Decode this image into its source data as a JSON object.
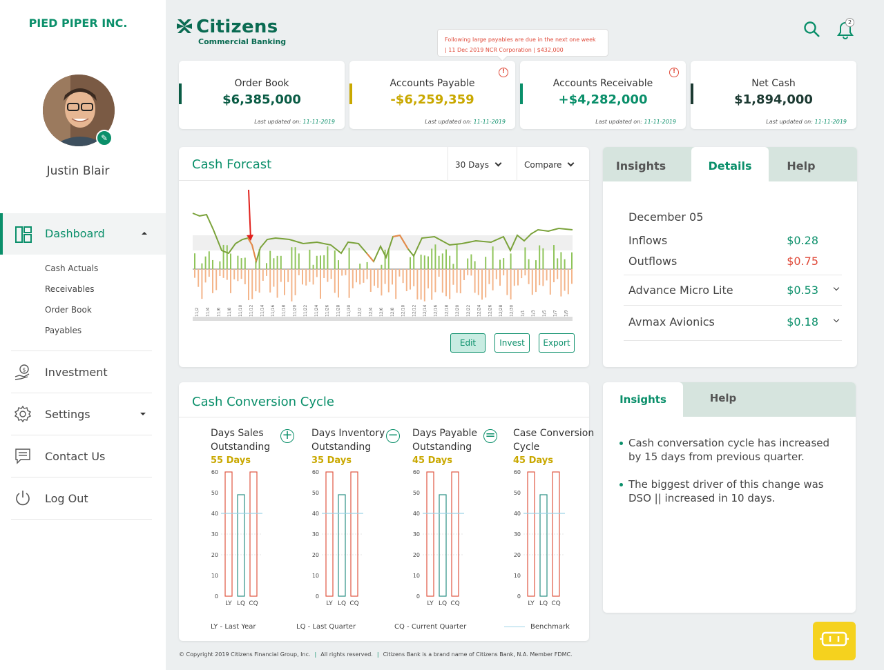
{
  "sidebar": {
    "company": "PIED PIPER INC.",
    "user_name": "Justin Blair",
    "active_item": "Dashboard",
    "sub_items": [
      "Cash Actuals",
      "Receivables",
      "Order Book",
      "Payables"
    ],
    "items": [
      "Investment",
      "Settings",
      "Contact Us",
      "Log Out"
    ]
  },
  "header": {
    "brand": "Citizens",
    "brand_sub": "Commercial Banking",
    "notification_count": "2"
  },
  "tooltip": {
    "line1": "Following large payables are due in the next one week",
    "line2": "| 11 Dec 2019 NCR Corporation  | $432,000"
  },
  "kpis": [
    {
      "title": "Order Book",
      "value": "$6,385,000",
      "updated_label": "Last updated on:",
      "updated": "11-11-2019",
      "color": "#0a5c45"
    },
    {
      "title": "Accounts Payable",
      "value": "-$6,259,359",
      "updated_label": "Last updated on:",
      "updated": "11-11-2019",
      "color": "#c9a800"
    },
    {
      "title": "Accounts Receivable",
      "value": "+$4,282,000",
      "updated_label": "Last updated on:",
      "updated": "11-11-2019",
      "color": "#0a8f6a"
    },
    {
      "title": "Net Cash",
      "value": "$1,894,000",
      "updated_label": "Last updated on:",
      "updated": "11-11-2019",
      "color": "#1c3a32"
    }
  ],
  "forecast": {
    "title": "Cash Forcast",
    "range": "30 Days",
    "compare": "Compare",
    "buttons": {
      "edit": "Edit",
      "invest": "Invest",
      "export": "Export"
    },
    "dates": [
      "11/2",
      "11/4",
      "11/6",
      "11/8",
      "11/10",
      "11/12",
      "11/14",
      "11/16",
      "11/18",
      "11/20",
      "11/22",
      "11/24",
      "11/26",
      "11/28",
      "11/30",
      "12/2",
      "12/4",
      "12/6",
      "12/8",
      "12/10",
      "12/12",
      "12/14",
      "12/16",
      "12/18",
      "12/20",
      "12/22",
      "12/24",
      "12/26",
      "12/28",
      "12/30",
      "1/1",
      "1/3",
      "1/5",
      "1/7",
      "1/9"
    ]
  },
  "details": {
    "tabs": [
      "Insights",
      "Details",
      "Help"
    ],
    "date": "December 05",
    "inflows_label": "Inflows",
    "inflows": "$0.28",
    "outflows_label": "Outflows",
    "outflows": "$0.75",
    "rows": [
      {
        "name": "Advance Micro Lite",
        "value": "$0.53"
      },
      {
        "name": "Avmax Avionics",
        "value": "$0.18"
      }
    ]
  },
  "ccc": {
    "title": "Cash Conversion Cycle",
    "columns": [
      {
        "l1": "Days Sales",
        "l2": "Outstanding",
        "days": "55 Days"
      },
      {
        "l1": "Days Inventory",
        "l2": "Outstanding",
        "days": "35 Days"
      },
      {
        "l1": "Days Payable",
        "l2": "Outstanding",
        "days": "45 Days"
      },
      {
        "l1": "Case Conversion",
        "l2": "Cycle",
        "days": "45 Days"
      }
    ],
    "legend": {
      "ly": "LY -  Last Year",
      "lq": "LQ -  Last Quarter",
      "cq": "CQ -  Current Quarter",
      "bm": "Benchmark"
    }
  },
  "chart_data": [
    {
      "type": "bar",
      "title": "",
      "categories": [
        "LY",
        "LQ",
        "CQ"
      ],
      "series": [
        {
          "values": [
            60,
            49,
            60
          ]
        }
      ],
      "ylim": [
        0,
        60
      ],
      "yticks": [
        0,
        10,
        20,
        30,
        40,
        50,
        60
      ],
      "benchmark": 40,
      "colors": {
        "LY": "#e0553f",
        "LQ": "#2a8f84",
        "CQ": "#e0553f",
        "benchmark": "#9cd3e8"
      }
    }
  ],
  "insights": {
    "tabs": [
      "Insights",
      "Help"
    ],
    "items": [
      "Cash conversation cycle has increased by 15 days from previous quarter.",
      "The biggest driver of this change was DSO  || increased in 10 days."
    ]
  },
  "footer": {
    "copyright": "© Copyright 2019 Citizens Financial Group, Inc.",
    "rights": "All rights reserved.",
    "brand_note": "Citizens Bank is a brand name of Citizens Bank, N.A. Member FDMC."
  }
}
